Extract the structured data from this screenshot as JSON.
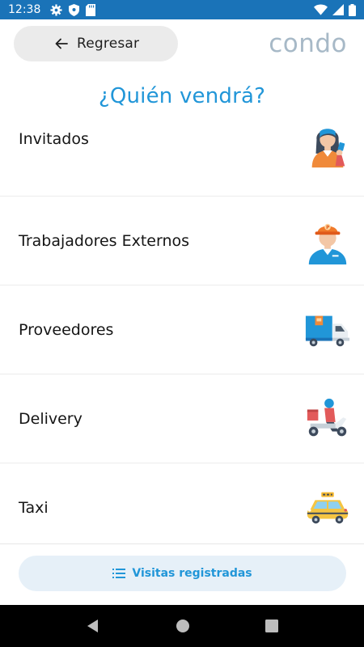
{
  "status_bar": {
    "time": "12:38",
    "left_icons": [
      "gear-icon",
      "shield-icon",
      "sd-card-icon"
    ],
    "right_icons": [
      "wifi-icon",
      "signal-icon",
      "battery-icon"
    ]
  },
  "header": {
    "back_label": "Regresar",
    "logo_text": "condo"
  },
  "title": "¿Quién vendrá?",
  "options": [
    {
      "label": "Invitados",
      "icon": "guest-woman-icon"
    },
    {
      "label": "Trabajadores Externos",
      "icon": "worker-icon"
    },
    {
      "label": "Proveedores",
      "icon": "delivery-truck-icon"
    },
    {
      "label": "Delivery",
      "icon": "scooter-courier-icon"
    },
    {
      "label": "Taxi",
      "icon": "taxi-icon"
    }
  ],
  "footer": {
    "visits_label": "Visitas registradas",
    "icon": "list-icon"
  },
  "nav_bar": {
    "icons": [
      "back-triangle-icon",
      "home-circle-icon",
      "recents-square-icon"
    ]
  },
  "colors": {
    "status_bar": "#1a73b8",
    "accent": "#2196d8",
    "logo": "#a7b9c7",
    "back_button_bg": "#ebebeb",
    "visits_button_bg": "#e6f0f8"
  }
}
